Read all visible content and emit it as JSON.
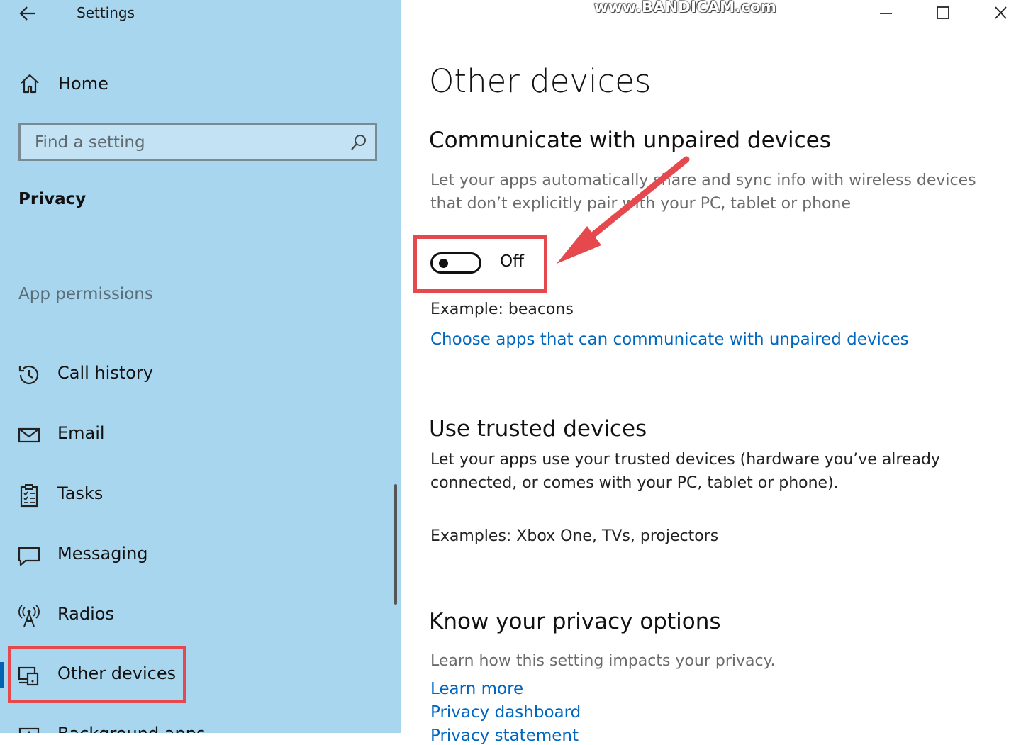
{
  "window": {
    "title": "Settings",
    "watermark": "www.BANDICAM.com"
  },
  "sidebar": {
    "home_label": "Home",
    "search_placeholder": "Find a setting",
    "section_title": "Privacy",
    "group_label": "App permissions",
    "items": [
      {
        "label": "Call history",
        "icon": "clock-history-icon"
      },
      {
        "label": "Email",
        "icon": "envelope-icon"
      },
      {
        "label": "Tasks",
        "icon": "clipboard-checklist-icon"
      },
      {
        "label": "Messaging",
        "icon": "chat-bubble-icon"
      },
      {
        "label": "Radios",
        "icon": "radio-antenna-icon"
      },
      {
        "label": "Other devices",
        "icon": "devices-icon",
        "active": true
      },
      {
        "label": "Background apps",
        "icon": "background-apps-icon"
      }
    ]
  },
  "main": {
    "page_title": "Other devices",
    "unpaired": {
      "heading": "Communicate with unpaired devices",
      "description": "Let your apps automatically share and sync info with wireless devices that don’t explicitly pair with your PC, tablet or phone",
      "toggle_state": "Off",
      "example": "Example: beacons",
      "link": "Choose apps that can communicate with unpaired devices"
    },
    "trusted": {
      "heading": "Use trusted devices",
      "description": "Let your apps use your trusted devices (hardware you’ve already connected, or comes with your PC, tablet or phone).",
      "examples": "Examples: Xbox One, TVs, projectors"
    },
    "privacy": {
      "heading": "Know your privacy options",
      "description": "Learn how this setting impacts your privacy.",
      "links": [
        "Learn more",
        "Privacy dashboard",
        "Privacy statement"
      ]
    }
  },
  "colors": {
    "sidebar_bg": "#a9d6ef",
    "link": "#0067c0",
    "annotation": "#e5484d",
    "active_indicator": "#0063b1"
  }
}
